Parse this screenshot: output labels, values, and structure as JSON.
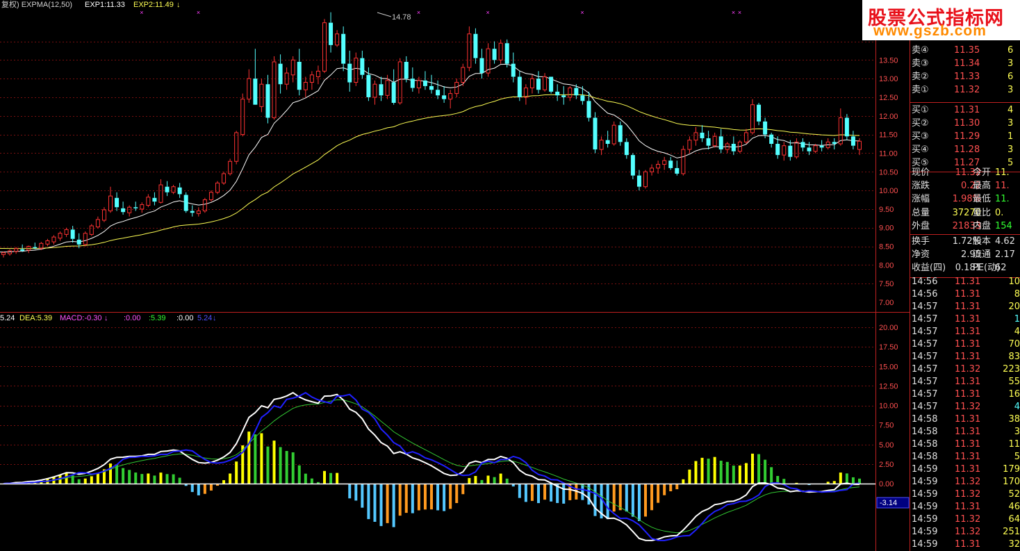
{
  "title_bar": {
    "ind_name": "复权) EXPMA(12,50)",
    "exp1": "EXP1:11.33",
    "exp2": "EXP2:11.49",
    "exp2_arrow": "↓"
  },
  "macd_bar": {
    "dif_label": "5.24",
    "dea_label": "DEA:5.39",
    "macd_label": "MACD:-0.30",
    "extra1": ":0.00",
    "extra2": ":5.39",
    "extra3": ":0.00",
    "extra4": "5.24",
    "arrow": "↓"
  },
  "peak_label": "14.78",
  "current_tag": "-3.14",
  "price_axis": [
    "13.50",
    "13.00",
    "12.50",
    "12.00",
    "11.50",
    "11.00",
    "10.50",
    "10.00",
    "9.50",
    "9.00",
    "8.50",
    "8.00",
    "7.50",
    "7.00"
  ],
  "macd_axis": [
    "20.00",
    "17.50",
    "15.00",
    "12.50",
    "10.00",
    "7.50",
    "5.00",
    "2.50",
    "0.00"
  ],
  "colors": {
    "up": "#ff3232",
    "down": "#54ffff",
    "exp1": "#ffffff",
    "exp2": "#ffff54",
    "grid": "#7a1010",
    "axis_text": "#ff5050",
    "macd_pos_yellow": "#ffff00",
    "macd_pos_green": "#32cd32",
    "macd_neg_blue": "#54c8ff",
    "macd_neg_orange": "#ff9a1f",
    "dif": "#ffffff",
    "dea": "#32c832",
    "extra_line": "#2020ff"
  },
  "logo": {
    "line1": "股票公式指标网",
    "line2": "www.gszb.com"
  },
  "order_book": {
    "sell": [
      {
        "label": "卖④",
        "price": "11.35",
        "vol": "6"
      },
      {
        "label": "卖③",
        "price": "11.34",
        "vol": "3"
      },
      {
        "label": "卖②",
        "price": "11.33",
        "vol": "6"
      },
      {
        "label": "卖①",
        "price": "11.32",
        "vol": "3"
      }
    ],
    "buy": [
      {
        "label": "买①",
        "price": "11.31",
        "vol": "4"
      },
      {
        "label": "买②",
        "price": "11.30",
        "vol": "3"
      },
      {
        "label": "买③",
        "price": "11.29",
        "vol": "1"
      },
      {
        "label": "买④",
        "price": "11.28",
        "vol": "3"
      },
      {
        "label": "买⑤",
        "price": "11.27",
        "vol": "5"
      }
    ]
  },
  "quote": [
    {
      "k1": "现价",
      "v1": "11.32",
      "c1": "#ff5050",
      "k2": "今开",
      "v2": "11.",
      "c2": "#ffff54"
    },
    {
      "k1": "涨跌",
      "v1": "0.22",
      "c1": "#ff5050",
      "k2": "最高",
      "v2": "11.",
      "c2": "#ff5050"
    },
    {
      "k1": "涨幅",
      "v1": "1.98%",
      "c1": "#ff5050",
      "k2": "最低",
      "v2": "11.",
      "c2": "#32ff32"
    },
    {
      "k1": "总量",
      "v1": "37270",
      "c1": "#ffff54",
      "k2": "量比",
      "v2": "0.",
      "c2": "#ffff54"
    },
    {
      "k1": "外盘",
      "v1": "21833",
      "c1": "#ff5050",
      "k2": "内盘",
      "v2": "154",
      "c2": "#32ff32"
    },
    {
      "k1": "换手",
      "v1": "1.72%",
      "c1": "#e0e0e0",
      "k2": "股本",
      "v2": "4.62",
      "c2": "#e0e0e0"
    },
    {
      "k1": "净资",
      "v1": "2.95",
      "c1": "#e0e0e0",
      "k2": "流通",
      "v2": "2.17",
      "c2": "#e0e0e0"
    },
    {
      "k1": "收益(四)",
      "v1": "0.181",
      "c1": "#e0e0e0",
      "k2": "PE(动)",
      "v2": "62",
      "c2": "#e0e0e0"
    }
  ],
  "ticks": [
    {
      "time": "14:56",
      "price": "11.31",
      "vol": "10"
    },
    {
      "time": "14:56",
      "price": "11.31",
      "vol": "8"
    },
    {
      "time": "14:57",
      "price": "11.31",
      "vol": "20"
    },
    {
      "time": "14:57",
      "price": "11.31",
      "vol": "1"
    },
    {
      "time": "14:57",
      "price": "11.31",
      "vol": "4"
    },
    {
      "time": "14:57",
      "price": "11.31",
      "vol": "70"
    },
    {
      "time": "14:57",
      "price": "11.31",
      "vol": "83"
    },
    {
      "time": "14:57",
      "price": "11.32",
      "vol": "223"
    },
    {
      "time": "14:57",
      "price": "11.31",
      "vol": "55"
    },
    {
      "time": "14:57",
      "price": "11.31",
      "vol": "16"
    },
    {
      "time": "14:57",
      "price": "11.32",
      "vol": "4"
    },
    {
      "time": "14:58",
      "price": "11.31",
      "vol": "38"
    },
    {
      "time": "14:58",
      "price": "11.31",
      "vol": "3"
    },
    {
      "time": "14:58",
      "price": "11.31",
      "vol": "11"
    },
    {
      "time": "14:58",
      "price": "11.31",
      "vol": "5"
    },
    {
      "time": "14:59",
      "price": "11.31",
      "vol": "179"
    },
    {
      "time": "14:59",
      "price": "11.32",
      "vol": "170"
    },
    {
      "time": "14:59",
      "price": "11.32",
      "vol": "52"
    },
    {
      "time": "14:59",
      "price": "11.31",
      "vol": "46"
    },
    {
      "time": "14:59",
      "price": "11.32",
      "vol": "64"
    },
    {
      "time": "14:59",
      "price": "11.32",
      "vol": "251"
    },
    {
      "time": "14:59",
      "price": "11.31",
      "vol": "32"
    }
  ],
  "tick_vol_colors": [
    "#ffff54",
    "#ffff54",
    "#ffff54",
    "#54ffff",
    "#ffff54",
    "#ffff54",
    "#ffff54",
    "#ffff54",
    "#ffff54",
    "#ffff54",
    "#54ffff",
    "#ffff54",
    "#ffff54",
    "#ffff54",
    "#ffff54",
    "#ffff54",
    "#ffff54",
    "#ffff54",
    "#ffff54",
    "#ffff54",
    "#ffff54",
    "#ffff54"
  ],
  "chart_data": {
    "type": "candlestick",
    "candles": [
      [
        8.28,
        8.36,
        8.2,
        8.33
      ],
      [
        8.3,
        8.42,
        8.25,
        8.38
      ],
      [
        8.36,
        8.48,
        8.3,
        8.44
      ],
      [
        8.42,
        8.55,
        8.35,
        8.38
      ],
      [
        8.4,
        8.52,
        8.32,
        8.5
      ],
      [
        8.48,
        8.6,
        8.42,
        8.45
      ],
      [
        8.45,
        8.62,
        8.4,
        8.58
      ],
      [
        8.56,
        8.7,
        8.5,
        8.65
      ],
      [
        8.62,
        8.8,
        8.55,
        8.75
      ],
      [
        8.72,
        8.9,
        8.65,
        8.85
      ],
      [
        8.82,
        9.0,
        8.75,
        8.95
      ],
      [
        8.95,
        9.05,
        8.6,
        8.7
      ],
      [
        8.68,
        8.85,
        8.45,
        8.55
      ],
      [
        8.55,
        8.9,
        8.5,
        8.85
      ],
      [
        8.82,
        9.1,
        8.78,
        9.05
      ],
      [
        9.02,
        9.3,
        8.98,
        9.22
      ],
      [
        9.2,
        9.55,
        9.15,
        9.48
      ],
      [
        9.45,
        10.1,
        9.4,
        9.85
      ],
      [
        9.8,
        9.95,
        9.45,
        9.55
      ],
      [
        9.52,
        9.7,
        9.35,
        9.42
      ],
      [
        9.4,
        9.6,
        9.3,
        9.55
      ],
      [
        9.55,
        9.7,
        9.45,
        9.52
      ],
      [
        9.5,
        9.68,
        9.4,
        9.62
      ],
      [
        9.6,
        9.9,
        9.55,
        9.82
      ],
      [
        9.8,
        9.95,
        9.6,
        9.7
      ],
      [
        9.68,
        10.3,
        9.65,
        10.15
      ],
      [
        10.1,
        10.25,
        9.85,
        9.95
      ],
      [
        9.95,
        10.15,
        9.9,
        10.1
      ],
      [
        10.08,
        10.2,
        9.8,
        9.9
      ],
      [
        9.88,
        9.95,
        9.4,
        9.45
      ],
      [
        9.45,
        9.6,
        9.3,
        9.4
      ],
      [
        9.38,
        9.55,
        9.3,
        9.45
      ],
      [
        9.45,
        9.8,
        9.4,
        9.75
      ],
      [
        9.75,
        10.0,
        9.7,
        9.95
      ],
      [
        9.95,
        10.25,
        9.9,
        10.2
      ],
      [
        10.2,
        10.5,
        10.15,
        10.45
      ],
      [
        10.45,
        10.85,
        10.4,
        10.78
      ],
      [
        10.78,
        11.6,
        10.7,
        11.55
      ],
      [
        11.5,
        12.6,
        11.45,
        12.45
      ],
      [
        12.45,
        13.25,
        12.35,
        13.0
      ],
      [
        13.0,
        13.8,
        12.8,
        12.3
      ],
      [
        12.25,
        13.0,
        12.1,
        12.85
      ],
      [
        12.85,
        13.1,
        11.8,
        11.95
      ],
      [
        11.95,
        13.6,
        11.9,
        13.45
      ],
      [
        13.4,
        13.65,
        12.6,
        12.85
      ],
      [
        12.85,
        13.3,
        12.7,
        13.15
      ],
      [
        13.1,
        13.6,
        12.9,
        13.5
      ],
      [
        13.45,
        13.8,
        12.55,
        12.7
      ],
      [
        12.7,
        13.05,
        12.5,
        12.9
      ],
      [
        12.9,
        13.2,
        12.7,
        13.1
      ],
      [
        13.05,
        13.35,
        12.85,
        13.2
      ],
      [
        13.2,
        14.6,
        13.15,
        14.5
      ],
      [
        14.5,
        14.78,
        13.7,
        13.9
      ],
      [
        13.9,
        14.3,
        13.85,
        14.2
      ],
      [
        14.2,
        14.4,
        13.2,
        13.4
      ],
      [
        13.4,
        13.75,
        12.65,
        12.9
      ],
      [
        12.9,
        13.7,
        12.8,
        13.55
      ],
      [
        13.55,
        13.75,
        13.0,
        13.1
      ],
      [
        13.1,
        13.3,
        12.4,
        12.5
      ],
      [
        12.5,
        12.95,
        12.3,
        12.85
      ],
      [
        12.85,
        13.05,
        12.4,
        12.55
      ],
      [
        12.55,
        13.1,
        12.45,
        12.95
      ],
      [
        12.9,
        13.25,
        12.3,
        12.35
      ],
      [
        12.35,
        13.55,
        12.3,
        13.45
      ],
      [
        13.45,
        13.6,
        12.9,
        13.0
      ],
      [
        13.0,
        13.3,
        12.65,
        12.75
      ],
      [
        12.75,
        13.05,
        12.6,
        12.95
      ],
      [
        12.95,
        13.2,
        12.7,
        12.8
      ],
      [
        12.8,
        13.1,
        12.6,
        12.7
      ],
      [
        12.7,
        12.95,
        12.45,
        12.55
      ],
      [
        12.55,
        12.8,
        12.35,
        12.45
      ],
      [
        12.45,
        12.7,
        12.2,
        12.6
      ],
      [
        12.6,
        13.0,
        12.5,
        12.9
      ],
      [
        12.9,
        13.4,
        12.8,
        13.3
      ],
      [
        13.3,
        14.4,
        13.2,
        14.2
      ],
      [
        14.2,
        14.35,
        13.4,
        13.55
      ],
      [
        13.55,
        13.8,
        13.0,
        13.15
      ],
      [
        13.15,
        13.95,
        13.05,
        13.8
      ],
      [
        13.8,
        14.0,
        13.4,
        13.5
      ],
      [
        13.5,
        14.05,
        13.4,
        13.95
      ],
      [
        13.95,
        14.05,
        13.3,
        13.4
      ],
      [
        13.4,
        13.7,
        12.9,
        13.05
      ],
      [
        13.05,
        13.2,
        12.4,
        12.5
      ],
      [
        12.5,
        12.85,
        12.3,
        12.75
      ],
      [
        12.75,
        13.1,
        12.6,
        13.0
      ],
      [
        13.0,
        13.2,
        12.6,
        12.7
      ],
      [
        12.7,
        13.15,
        12.65,
        13.05
      ],
      [
        13.05,
        13.05,
        12.6,
        12.65
      ],
      [
        12.65,
        12.85,
        12.4,
        12.55
      ],
      [
        12.55,
        12.8,
        12.3,
        12.5
      ],
      [
        12.5,
        12.8,
        12.4,
        12.75
      ],
      [
        12.75,
        12.85,
        12.45,
        12.55
      ],
      [
        12.55,
        12.8,
        12.3,
        12.4
      ],
      [
        12.4,
        12.65,
        11.85,
        11.95
      ],
      [
        11.95,
        12.1,
        11.0,
        11.1
      ],
      [
        11.1,
        11.45,
        10.95,
        11.35
      ],
      [
        11.35,
        11.6,
        11.15,
        11.25
      ],
      [
        11.25,
        11.85,
        11.2,
        11.75
      ],
      [
        11.75,
        11.85,
        11.2,
        11.3
      ],
      [
        11.3,
        11.4,
        10.85,
        10.95
      ],
      [
        10.95,
        11.0,
        10.3,
        10.4
      ],
      [
        10.4,
        10.55,
        10.0,
        10.1
      ],
      [
        10.1,
        10.55,
        10.05,
        10.5
      ],
      [
        10.5,
        10.7,
        10.4,
        10.6
      ],
      [
        10.6,
        10.8,
        10.45,
        10.7
      ],
      [
        10.7,
        10.9,
        10.55,
        10.8
      ],
      [
        10.8,
        10.9,
        10.55,
        10.6
      ],
      [
        10.6,
        10.8,
        10.4,
        10.45
      ],
      [
        10.45,
        11.2,
        10.4,
        11.1
      ],
      [
        11.1,
        11.45,
        11.0,
        11.35
      ],
      [
        11.35,
        11.7,
        11.2,
        11.55
      ],
      [
        11.55,
        11.75,
        11.3,
        11.4
      ],
      [
        11.4,
        11.6,
        11.1,
        11.2
      ],
      [
        11.2,
        11.55,
        11.15,
        11.45
      ],
      [
        11.45,
        11.65,
        11.0,
        11.1
      ],
      [
        11.1,
        11.3,
        11.0,
        11.25
      ],
      [
        11.25,
        11.45,
        10.95,
        11.05
      ],
      [
        11.05,
        11.35,
        11.0,
        11.3
      ],
      [
        11.3,
        11.65,
        11.25,
        11.55
      ],
      [
        11.55,
        12.45,
        11.5,
        12.3
      ],
      [
        12.3,
        12.35,
        11.75,
        11.85
      ],
      [
        11.85,
        11.95,
        11.4,
        11.5
      ],
      [
        11.5,
        11.55,
        11.15,
        11.25
      ],
      [
        11.25,
        11.45,
        10.85,
        10.95
      ],
      [
        10.95,
        11.3,
        10.8,
        11.2
      ],
      [
        11.2,
        11.35,
        10.8,
        10.9
      ],
      [
        10.9,
        11.4,
        10.85,
        11.3
      ],
      [
        11.3,
        11.4,
        11.05,
        11.15
      ],
      [
        11.15,
        11.3,
        10.95,
        11.05
      ],
      [
        11.05,
        11.25,
        11.0,
        11.2
      ],
      [
        11.2,
        11.35,
        11.05,
        11.15
      ],
      [
        11.15,
        11.4,
        11.1,
        11.3
      ],
      [
        11.3,
        11.4,
        11.1,
        11.25
      ],
      [
        11.25,
        12.2,
        11.2,
        11.95
      ],
      [
        11.95,
        12.05,
        11.35,
        11.45
      ],
      [
        11.45,
        11.6,
        11.1,
        11.2
      ],
      [
        11.1,
        11.4,
        10.95,
        11.32
      ]
    ]
  }
}
